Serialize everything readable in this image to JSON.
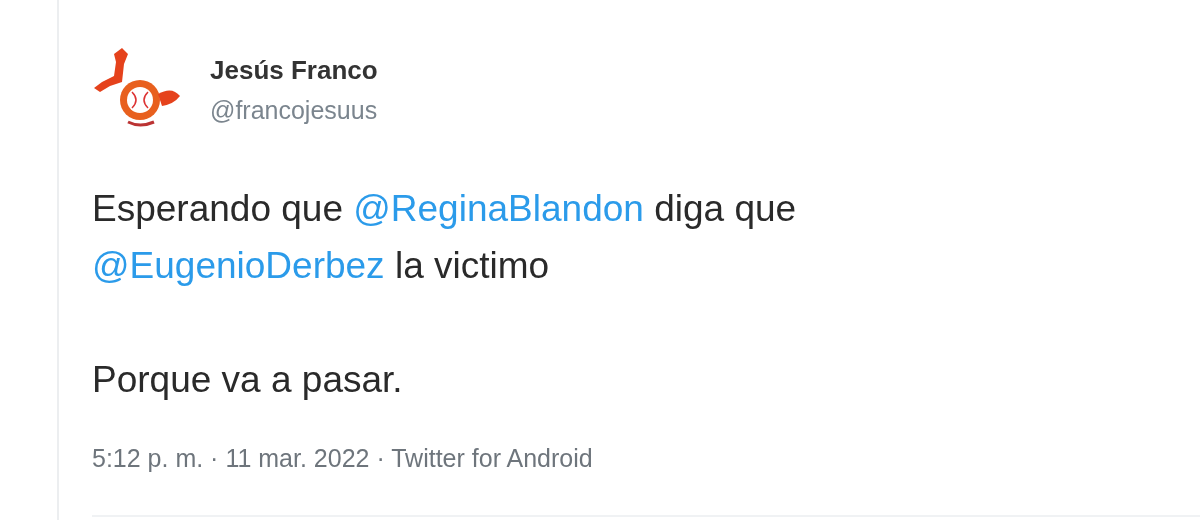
{
  "tweet": {
    "author": {
      "name": "Jesús Franco",
      "handle": "@francojesuus"
    },
    "paragraphs": [
      {
        "lines": [
          [
            {
              "kind": "text",
              "text": "Esperando que "
            },
            {
              "kind": "mention",
              "text": "@ReginaBlandon"
            },
            {
              "kind": "text",
              "text": " diga que"
            }
          ],
          [
            {
              "kind": "mention",
              "text": "@EugenioDerbez"
            },
            {
              "kind": "text",
              "text": " la victimo"
            }
          ]
        ]
      },
      {
        "lines": [
          [
            {
              "kind": "text",
              "text": "Porque va a pasar."
            }
          ]
        ]
      }
    ],
    "meta": "5:12 p. m. · 11 mar. 2022 · Twitter for Android"
  }
}
